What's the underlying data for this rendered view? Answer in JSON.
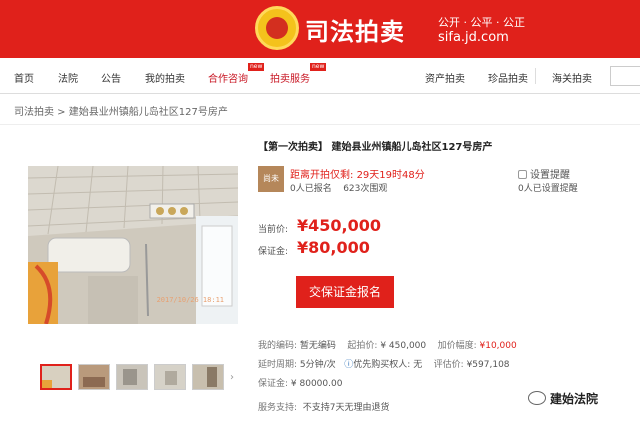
{
  "banner": {
    "brand": "司法拍卖",
    "slogan": "公开 · 公平 · 公正",
    "site": "sifa.jd.com"
  },
  "nav": {
    "items": [
      "首页",
      "法院",
      "公告",
      "我的拍卖",
      "合作咨询",
      "拍卖服务",
      "资产拍卖",
      "珍品拍卖",
      "海关拍卖"
    ],
    "badge": "new"
  },
  "breadcrumb": "司法拍卖 > 建始县业州镇船儿岛社区127号房产",
  "title": "【第一次拍卖】 建始县业州镇船儿岛社区127号房产",
  "photo_stamp": "2017/10/26 18:11",
  "auction_badge": "尚未",
  "countdown": {
    "label": "距离开拍仅剩:",
    "time": "29天19时48分"
  },
  "stats": {
    "signups": "0人已报名",
    "views": "623次围观"
  },
  "remind": {
    "label": "设置提醒",
    "count": "0人已设置提醒"
  },
  "price": {
    "current_label": "当前价:",
    "current": "¥450,000",
    "deposit_label": "保证金:",
    "deposit": "¥80,000"
  },
  "deposit_button": "交保证金报名",
  "info": {
    "code_label": "我的编码:",
    "code": "暂无编码",
    "start_label": "起拍价:",
    "start": "¥ 450,000",
    "inc_label": "加价幅度:",
    "inc": "¥10,000",
    "delay_label": "延时周期:",
    "delay": "5分钟/次",
    "priority": "优先购买权人: 无",
    "assess_label": "评估价:",
    "assess": "¥597,108",
    "deposit_label": "保证金:",
    "deposit": "¥ 80000.00",
    "service_label": "服务支持:",
    "service": "不支持7天无理由退货"
  },
  "watermark": "建始法院"
}
